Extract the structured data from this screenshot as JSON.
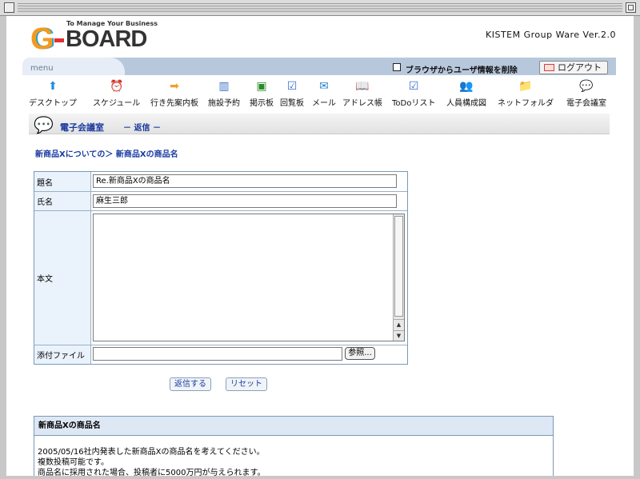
{
  "header": {
    "logo_tagline": "To Manage Your Business",
    "logo_g": "G",
    "logo_text": "BOARD",
    "version": "KISTEM Group Ware Ver.2.0"
  },
  "menu": {
    "label": "menu",
    "clear_user_info_label": "ブラウザからユーザ情報を削除",
    "logout_label": "ログアウト"
  },
  "nav": [
    {
      "label": "デスクトップ",
      "icon": "up-arrow-icon",
      "color": "#1f8fe0",
      "glyph": "⬆"
    },
    {
      "label": "スケジュール",
      "icon": "alarm-clock-icon",
      "color": "#2a9a2a",
      "glyph": "⏰"
    },
    {
      "label": "行き先案内板",
      "icon": "arrow-sign-icon",
      "color": "#f0a020",
      "glyph": "➡"
    },
    {
      "label": "施設予約",
      "icon": "building-icon",
      "color": "#3a70c8",
      "glyph": "▥"
    },
    {
      "label": "掲示板",
      "icon": "board-icon",
      "color": "#2a8a2a",
      "glyph": "▣"
    },
    {
      "label": "回覧板",
      "icon": "clipboard-check-icon",
      "color": "#3a70c8",
      "glyph": "☑"
    },
    {
      "label": "メール",
      "icon": "mail-icon",
      "color": "#2a80d0",
      "glyph": "✉"
    },
    {
      "label": "アドレス帳",
      "icon": "address-book-icon",
      "color": "#e8a020",
      "glyph": "📖"
    },
    {
      "label": "ToDoリスト",
      "icon": "todo-check-icon",
      "color": "#3a70c8",
      "glyph": "☑"
    },
    {
      "label": "人員構成図",
      "icon": "people-icon",
      "color": "#3a70c8",
      "glyph": "👥"
    },
    {
      "label": "ネットフォルダ",
      "icon": "folder-icon",
      "color": "#e8a020",
      "glyph": "📁"
    },
    {
      "label": "電子会議室",
      "icon": "conference-icon",
      "color": "#e8a020",
      "glyph": "💬"
    }
  ],
  "section": {
    "title": "電子会議室",
    "mode": "－ 返信 －"
  },
  "breadcrumb": "新商品Xについての＞ 新商品Xの商品名",
  "form": {
    "subject_label": "題名",
    "subject_value": "Re.新商品Xの商品名",
    "name_label": "氏名",
    "name_value": "麻生三郎",
    "body_label": "本文",
    "attachment_label": "添付ファイル",
    "browse_label": "参照...",
    "submit_label": "返信する",
    "reset_label": "リセット"
  },
  "original": {
    "title": "新商品Xの商品名",
    "lines": [
      "2005/05/16社内発表した新商品Xの商品名を考えてください。",
      "複数投稿可能です。",
      "商品名に採用された場合、投稿者に5000万円が与えられます。"
    ]
  }
}
